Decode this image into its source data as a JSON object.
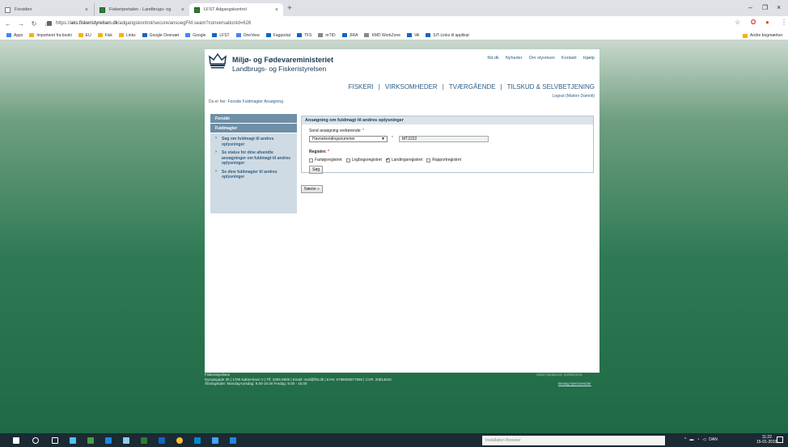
{
  "tabs": [
    {
      "title": "Forsiden"
    },
    {
      "title": "Fiskeriportalen - Landbrugs- og"
    },
    {
      "title": "LFST Adgangskontrol"
    }
  ],
  "address": {
    "scheme": "https://",
    "host": "aks.fiskeristyrelsen.dk",
    "path": "/adgangskontrol/secure/ansoegFM.seam?conversationId=626"
  },
  "bookmarks": [
    "Apps",
    "Importeret fra booki",
    "EU",
    "Fisk",
    "Links",
    "Google Oversæt",
    "Google",
    "LFST",
    "OneView",
    "Fagportal",
    "TFS",
    "mTID",
    "JIRA",
    "KMD WorkZone",
    "VA",
    "SIT-Links til applikat"
  ],
  "bookmarks_right": "Andre bogmærker",
  "header": {
    "ministry": "Miljø- og Fødevareministeriet",
    "agency": "Landbrugs- og Fiskeristyrelsen",
    "toplinks": [
      "lfst.dk",
      "Nyheder",
      "Om styrelsen",
      "Kontakt",
      "Hjælp"
    ],
    "mainnav": [
      "FISKERI",
      "VIRKSOMHEDER",
      "TVÆRGÅENDE",
      "TILSKUD & SELVBETJENING"
    ],
    "logout": "Logout (Marlon Damoti)"
  },
  "breadcrumb": {
    "prefix": "Du er her:",
    "path": "Forside Fuldmagter Ansøgning"
  },
  "sidebar": {
    "items": [
      {
        "label": "Forside"
      },
      {
        "label": "Fuldmagter"
      },
      {
        "label": "Søg om fuldmagt til andres oplysninger"
      },
      {
        "label": "Se status for dine afsendte ansøgninger om fuldmagt til andres oplysninger"
      },
      {
        "label": "Se dine fuldmagter til andres oplysninger"
      }
    ]
  },
  "form": {
    "title": "Ansøgning om fuldmagt til andres oplysninger",
    "send_label": "Send ansøgning vedrørende:",
    "select_value": "Havnekendingsnummer",
    "text_value": "MT2222",
    "registers_label": "Registre:",
    "checkboxes": [
      {
        "label": "Fartøjsregistret",
        "checked": false
      },
      {
        "label": "Logbogsregistret",
        "checked": false
      },
      {
        "label": "Landingsregistret",
        "checked": true
      },
      {
        "label": "Rapportregistret",
        "checked": false
      }
    ],
    "search_button": "Søg",
    "next_button": "Næste »"
  },
  "footer": {
    "org": "Fiskeristyrelsen",
    "line1": "Nyropsgade 30 | 1780 København V | Tlf. 3395 8000 | Email: mail@lfst.dk | EAN: 5798000877955 | CVR: 20814616",
    "line2": "Åbningstider: Mandag-torsdag: 9.00-16.00 Fredag: 9.00 - 15.00",
    "right_top": "Sidst Opdateret: 24/05/2018",
    "privacy": "Besøg Hjemmesider"
  },
  "taskbar": {
    "search_placeholder": "Installation Browser",
    "tray_lang": "DAN",
    "time": "11:22",
    "date": "15-01-2019"
  }
}
